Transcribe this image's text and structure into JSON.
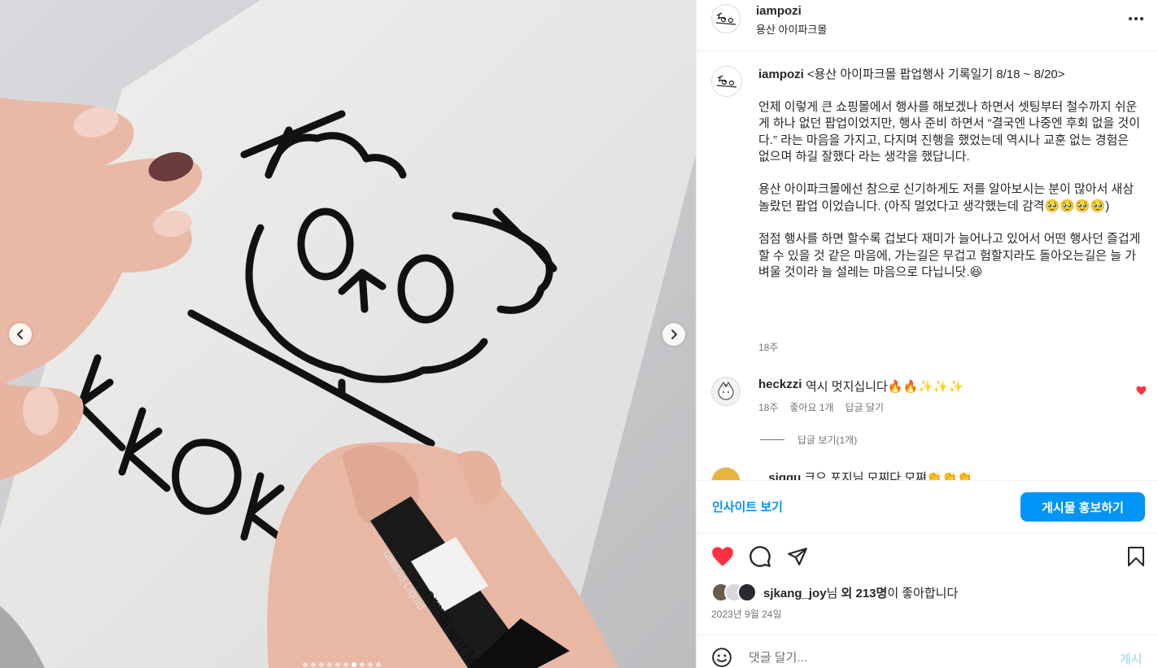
{
  "header": {
    "username": "iampozi",
    "location": "용산 아이파크몰",
    "more_icon": "more-horizontal-icon"
  },
  "media": {
    "marker_text_1": "ermanent Marker",
    "marker_text_2": "umario Liquid",
    "dots_total": 10,
    "dots_active_index": 6
  },
  "caption": {
    "username": "iampozi",
    "title": "<용산 아이파크몰 팝업행사 기록일기 8/18 ~ 8/20>",
    "body": "언제 이렇게 큰 쇼핑몰에서 행사를 해보겠나 하면서 셋팅부터 철수까지 쉬운게 하나 없던 팝업이었지만, 행사 준비 하면서 “결국엔 나중엔 후회 없을 것이다.” 라는 마음을 가지고, 다지며 진행을 했었는데 역시나 교훈 없는 경험은 없으며 하길 잘했다 라는 생각을 했답니다.\n\n용산 아이파크몰에선 참으로 신기하게도 저를 알아보시는 분이 많아서 새삼 놀랐던 팝업 이었습니다. (아직 멀었다고 생각했는데 감격🥹🥹🥹🥹)\n\n점점 행사를 하면 할수록 겁보다 재미가 늘어나고 있어서 어떤 행사던 즐겁게 할 수 있을 것 같은 마음에, 가는길은 무겁고 험할지라도 돌아오는길은 늘 가벼울 것이라 늘 설레는 마음으로 다닙니닷.😆",
    "time": "18주"
  },
  "comments": [
    {
      "username": "heckzzi",
      "text": "역시 멋지십니다🔥🔥✨✨✨",
      "time": "18주",
      "likes": "좋아요 1개",
      "reply": "답글 달기",
      "view_replies": "답글 보기(1개)"
    },
    {
      "username": "_sjggu",
      "text": "크으 포지님 모찌다 모쪄👏👏👏"
    }
  ],
  "insight": {
    "link": "인사이트 보기",
    "promote": "게시물 홍보하기"
  },
  "likes": {
    "user": "sjkang_joy",
    "suffix_1": "님 ",
    "count": "외 213명",
    "suffix_2": "이 좋아합니다"
  },
  "date": "2023년 9월 24일",
  "comment_box": {
    "placeholder": "댓글 달기...",
    "post": "게시"
  },
  "colors": {
    "accent": "#0095f6",
    "like_red": "#ff3040",
    "muted": "#737373"
  }
}
